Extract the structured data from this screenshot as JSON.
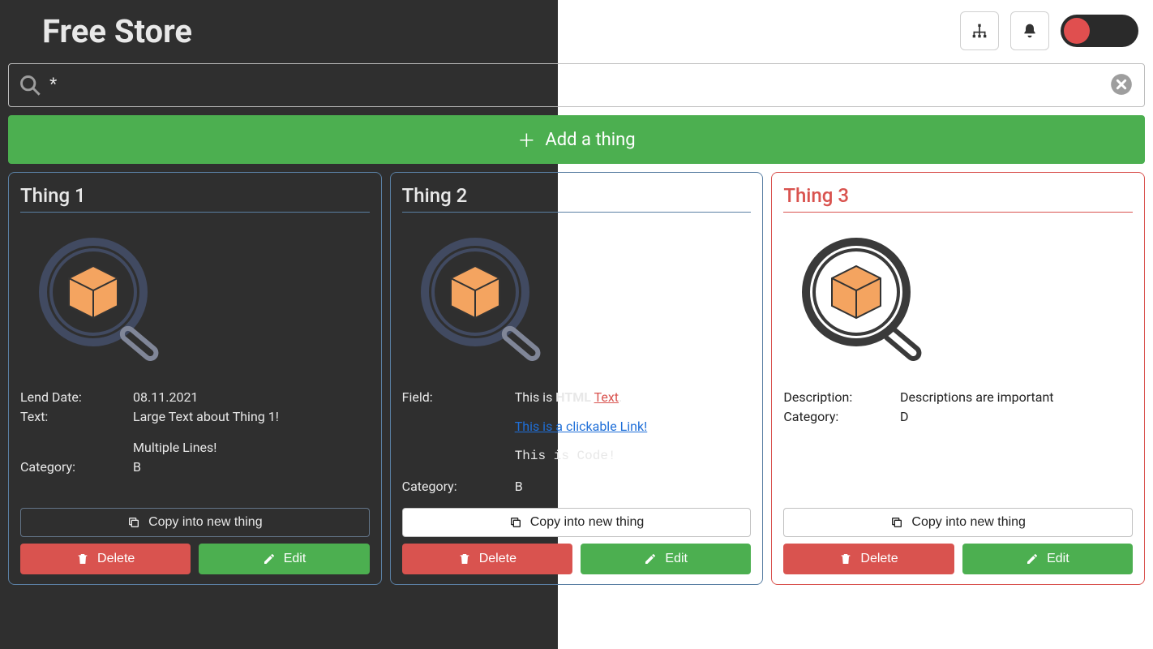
{
  "app_title": "Free Store",
  "search": {
    "value": "*"
  },
  "add_button_label": "Add a thing",
  "card_actions": {
    "copy": "Copy into new thing",
    "delete": "Delete",
    "edit": "Edit"
  },
  "cards": [
    {
      "title": "Thing 1",
      "lend_date_label": "Lend Date:",
      "lend_date_value": "08.11.2021",
      "text_label": "Text:",
      "text_line1": "Large Text about Thing 1!",
      "text_line2": "Multiple Lines!",
      "category_label": "Category:",
      "category_value": "B"
    },
    {
      "title": "Thing 2",
      "field_label": "Field:",
      "html_prefix": "This is ",
      "html_bold": "HTML",
      "html_red": "Text",
      "html_suffix": ".",
      "link_text": "This is a clickable Link!",
      "code_text": "This is Code!",
      "category_label": "Category:",
      "category_value": "B"
    },
    {
      "title": "Thing 3",
      "description_label": "Description:",
      "description_value": "Descriptions are important",
      "category_label": "Category:",
      "category_value": "D"
    }
  ]
}
